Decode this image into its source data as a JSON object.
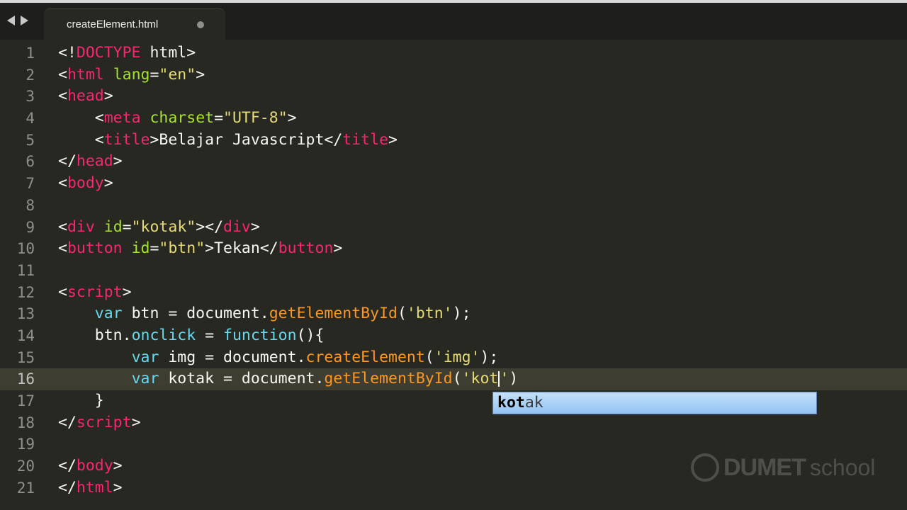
{
  "tab": {
    "filename": "createElement.html"
  },
  "editor": {
    "current_line": 16,
    "line_numbers": [
      "1",
      "2",
      "3",
      "4",
      "5",
      "6",
      "7",
      "8",
      "9",
      "10",
      "11",
      "12",
      "13",
      "14",
      "15",
      "16",
      "17",
      "18",
      "19",
      "20",
      "21"
    ],
    "lines": [
      [
        [
          "t-plain",
          "<!"
        ],
        [
          "t-tag",
          "DOCTYPE"
        ],
        [
          "t-plain",
          " html>"
        ]
      ],
      [
        [
          "t-plain",
          "<"
        ],
        [
          "t-tag",
          "html"
        ],
        [
          "t-plain",
          " "
        ],
        [
          "t-attr",
          "lang"
        ],
        [
          "t-plain",
          "="
        ],
        [
          "t-str",
          "\"en\""
        ],
        [
          "t-plain",
          ">"
        ]
      ],
      [
        [
          "t-plain",
          "<"
        ],
        [
          "t-tag",
          "head"
        ],
        [
          "t-plain",
          ">"
        ]
      ],
      [
        [
          "t-plain",
          "    <"
        ],
        [
          "t-tag",
          "meta"
        ],
        [
          "t-plain",
          " "
        ],
        [
          "t-attr",
          "charset"
        ],
        [
          "t-plain",
          "="
        ],
        [
          "t-str",
          "\"UTF-8\""
        ],
        [
          "t-plain",
          ">"
        ]
      ],
      [
        [
          "t-plain",
          "    <"
        ],
        [
          "t-tag",
          "title"
        ],
        [
          "t-plain",
          ">Belajar Javascript</"
        ],
        [
          "t-tag",
          "title"
        ],
        [
          "t-plain",
          ">"
        ]
      ],
      [
        [
          "t-plain",
          "</"
        ],
        [
          "t-tag",
          "head"
        ],
        [
          "t-plain",
          ">"
        ]
      ],
      [
        [
          "t-plain",
          "<"
        ],
        [
          "t-tag",
          "body"
        ],
        [
          "t-plain",
          ">"
        ]
      ],
      [
        [
          "t-plain",
          ""
        ]
      ],
      [
        [
          "t-plain",
          "<"
        ],
        [
          "t-tag",
          "div"
        ],
        [
          "t-plain",
          " "
        ],
        [
          "t-attr",
          "id"
        ],
        [
          "t-plain",
          "="
        ],
        [
          "t-str",
          "\"kotak\""
        ],
        [
          "t-plain",
          "></"
        ],
        [
          "t-tag",
          "div"
        ],
        [
          "t-plain",
          ">"
        ]
      ],
      [
        [
          "t-plain",
          "<"
        ],
        [
          "t-tag",
          "button"
        ],
        [
          "t-plain",
          " "
        ],
        [
          "t-attr",
          "id"
        ],
        [
          "t-plain",
          "="
        ],
        [
          "t-str",
          "\"btn\""
        ],
        [
          "t-plain",
          ">Tekan</"
        ],
        [
          "t-tag",
          "button"
        ],
        [
          "t-plain",
          ">"
        ]
      ],
      [
        [
          "t-plain",
          ""
        ]
      ],
      [
        [
          "t-plain",
          "<"
        ],
        [
          "t-tag",
          "script"
        ],
        [
          "t-plain",
          ">"
        ]
      ],
      [
        [
          "t-plain",
          "    "
        ],
        [
          "t-kw",
          "var"
        ],
        [
          "t-plain",
          " btn = document."
        ],
        [
          "t-fn",
          "getElementById"
        ],
        [
          "t-plain",
          "("
        ],
        [
          "t-str",
          "'btn'"
        ],
        [
          "t-plain",
          ");"
        ]
      ],
      [
        [
          "t-plain",
          "    btn."
        ],
        [
          "t-kw",
          "onclick"
        ],
        [
          "t-plain",
          " = "
        ],
        [
          "t-kw",
          "function"
        ],
        [
          "t-plain",
          "(){"
        ]
      ],
      [
        [
          "t-plain",
          "        "
        ],
        [
          "t-kw",
          "var"
        ],
        [
          "t-plain",
          " img = document."
        ],
        [
          "t-fn",
          "createElement"
        ],
        [
          "t-plain",
          "("
        ],
        [
          "t-str",
          "'img'"
        ],
        [
          "t-plain",
          ");"
        ]
      ],
      [
        [
          "t-plain",
          "        "
        ],
        [
          "t-kw",
          "var"
        ],
        [
          "t-plain",
          " kotak = document."
        ],
        [
          "t-fn",
          "getElementById"
        ],
        [
          "t-plain",
          "("
        ],
        [
          "t-str",
          "'kot"
        ],
        [
          "cursor",
          ""
        ],
        [
          "t-str",
          "'"
        ],
        [
          "t-plain",
          ")"
        ]
      ],
      [
        [
          "t-plain",
          "    }"
        ]
      ],
      [
        [
          "t-plain",
          "</"
        ],
        [
          "t-tag",
          "script"
        ],
        [
          "t-plain",
          ">"
        ]
      ],
      [
        [
          "t-plain",
          ""
        ]
      ],
      [
        [
          "t-plain",
          "</"
        ],
        [
          "t-tag",
          "body"
        ],
        [
          "t-plain",
          ">"
        ]
      ],
      [
        [
          "t-plain",
          "</"
        ],
        [
          "t-tag",
          "html"
        ],
        [
          "t-plain",
          ">"
        ]
      ]
    ]
  },
  "autocomplete": {
    "typed": "kot",
    "completion": "ak"
  },
  "watermark": {
    "brand_bold": "DUMET",
    "brand_light": "school"
  }
}
